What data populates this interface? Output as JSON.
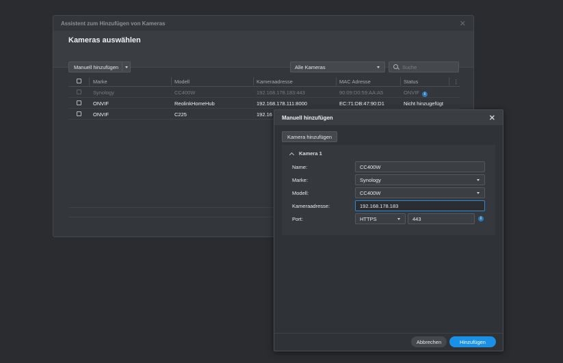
{
  "wizard": {
    "title": "Assistent zum Hinzufügen von Kameras",
    "heading": "Kameras auswählen",
    "add_manual_label": "Manuell hinzufügen",
    "filter_value": "Alle Kameras",
    "search_placeholder": "Suche",
    "table": {
      "headers": [
        "Marke",
        "Modell",
        "Kameraadresse",
        "MAC Adresse",
        "Status"
      ],
      "rows": [
        {
          "brand": "Synology",
          "model": "CC400W",
          "address": "192.168.178.183:443",
          "mac": "90:09:D0:59:AA:A5",
          "status": "ONVIF",
          "disabled": true
        },
        {
          "brand": "ONVIF",
          "model": "ReolinkHomeHub",
          "address": "192.168.178.111:8000",
          "mac": "EC:71:DB:47:90:D1",
          "status": "Nicht hinzugefügt",
          "disabled": false
        },
        {
          "brand": "ONVIF",
          "model": "C225",
          "address": "192.16",
          "mac": "",
          "status": "",
          "disabled": false
        }
      ]
    }
  },
  "dialog": {
    "title": "Manuell hinzufügen",
    "add_camera_label": "Kamera hinzufügen",
    "section_title": "Kamera 1",
    "form": {
      "name_label": "Name:",
      "name_value": "CC400W",
      "brand_label": "Marke:",
      "brand_value": "Synology",
      "model_label": "Modell:",
      "model_value": "CC400W",
      "address_label": "Kameraadresse:",
      "address_value": "192.168.178.183",
      "port_label": "Port:",
      "protocol_value": "HTTPS",
      "port_value": "443"
    },
    "cancel_label": "Abbrechen",
    "submit_label": "Hinzufügen"
  },
  "colors": {
    "accent": "#1a91e6",
    "info": "#2f78b5"
  }
}
